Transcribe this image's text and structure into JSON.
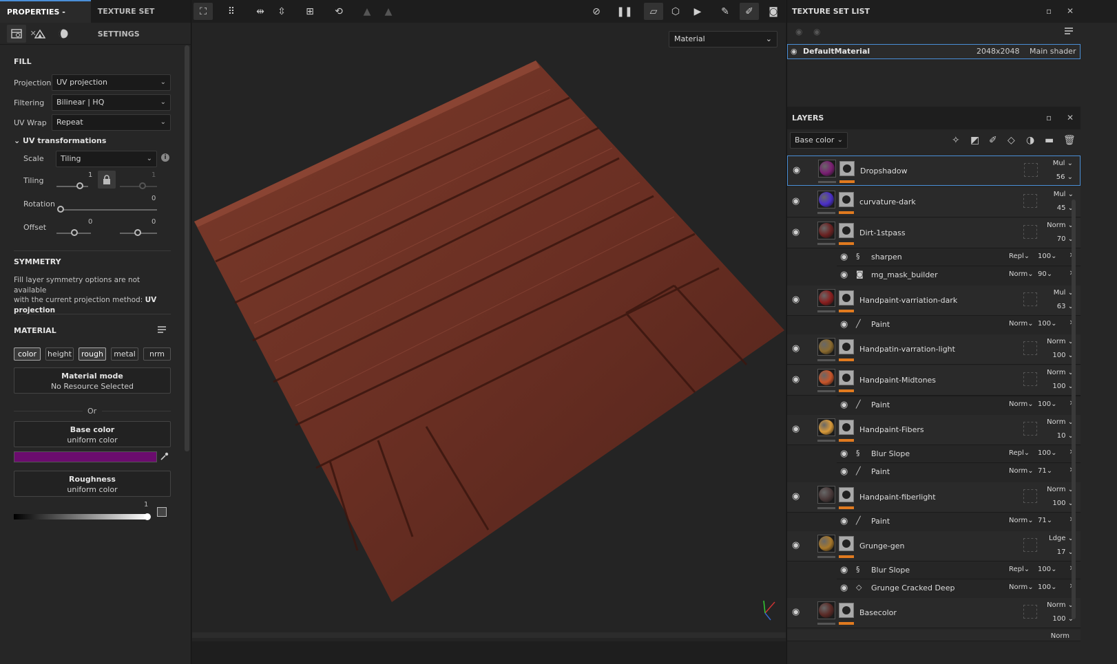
{
  "left": {
    "tabs": [
      {
        "label": "PROPERTIES - FILL",
        "close": "✕"
      },
      {
        "label": "TEXTURE SET SETTINGS"
      }
    ],
    "subtabs": [
      "layer-settings-icon",
      "mountain-icon",
      "material-sphere-icon"
    ],
    "fill": {
      "title": "FILL",
      "projection": {
        "label": "Projection",
        "value": "UV projection"
      },
      "filtering": {
        "label": "Filtering",
        "value": "Bilinear | HQ"
      },
      "uvwrap": {
        "label": "UV Wrap",
        "value": "Repeat"
      },
      "uvt": {
        "label": "UV transformations",
        "scale": {
          "label": "Scale",
          "value": "Tiling"
        },
        "tiling": {
          "label": "Tiling",
          "v1": "1",
          "v2": "1"
        },
        "rotation": {
          "label": "Rotation",
          "value": "0"
        },
        "offset": {
          "label": "Offset",
          "v1": "0",
          "v2": "0"
        }
      }
    },
    "symmetry": {
      "title": "SYMMETRY",
      "text1": "Fill layer symmetry options are not available",
      "text2": "with the current projection method: ",
      "strong": "UV",
      "text3": "projection"
    },
    "material": {
      "title": "MATERIAL",
      "chips": [
        "color",
        "height",
        "rough",
        "metal",
        "nrm"
      ],
      "mode": {
        "title": "Material mode",
        "sub": "No Resource Selected"
      },
      "or": "Or",
      "base": {
        "title": "Base color",
        "sub": "uniform color",
        "color": "#6b0c6e"
      },
      "rough": {
        "title": "Roughness",
        "sub": "uniform color",
        "value": "1"
      }
    }
  },
  "viewport": {
    "dropdown": "Material"
  },
  "right": {
    "tsl": {
      "title": "TEXTURE SET LIST",
      "row": {
        "name": "DefaultMaterial",
        "res": "2048x2048",
        "shader": "Main shader"
      }
    },
    "layers": {
      "title": "LAYERS",
      "channel": "Base color",
      "items": [
        {
          "name": "Dropshadow",
          "blend": "Mul",
          "op": "56",
          "color": "#7a1f72"
        },
        {
          "name": "curvature-dark",
          "blend": "Mul",
          "op": "45",
          "color": "#4a2fc8"
        },
        {
          "name": "Dirt-1stpass",
          "blend": "Norm",
          "op": "70",
          "color": "#6b2222"
        },
        {
          "name": "Handpaint-varriation-dark",
          "blend": "Mul",
          "op": "63",
          "color": "#8a1f1f"
        },
        {
          "name": "Handpatin-varration-light",
          "blend": "Norm",
          "op": "100",
          "color": "#8a6a2f"
        },
        {
          "name": "Handpaint-Midtones",
          "blend": "Norm",
          "op": "100",
          "color": "#c8552a"
        },
        {
          "name": "Handpaint-Fibers",
          "blend": "Norm",
          "op": "10",
          "color": "#d89a3a"
        },
        {
          "name": "Handpaint-fiberlight",
          "blend": "Norm",
          "op": "100",
          "color": "#4a3a3a"
        },
        {
          "name": "Grunge-gen",
          "blend": "Ldge",
          "op": "17",
          "color": "#a8782a"
        },
        {
          "name": "Basecolor",
          "blend": "Norm",
          "op": "100",
          "color": "#5a2a26"
        }
      ],
      "subs": [
        {
          "name": "sharpen",
          "blend": "Repl",
          "op": "100"
        },
        {
          "name": "mg_mask_builder",
          "blend": "Norm",
          "op": "90"
        },
        {
          "name": "Paint",
          "blend": "Norm",
          "op": "100"
        },
        {
          "name": "Paint",
          "blend": "Norm",
          "op": "100"
        },
        {
          "name": "Blur Slope",
          "blend": "Repl",
          "op": "100"
        },
        {
          "name": "Paint",
          "blend": "Norm",
          "op": "71"
        },
        {
          "name": "Paint",
          "blend": "Norm",
          "op": "71"
        },
        {
          "name": "Blur Slope",
          "blend": "Repl",
          "op": "100"
        },
        {
          "name": "Grunge Cracked Deep",
          "blend": "Norm",
          "op": "100"
        }
      ],
      "partial": "Norm"
    }
  }
}
